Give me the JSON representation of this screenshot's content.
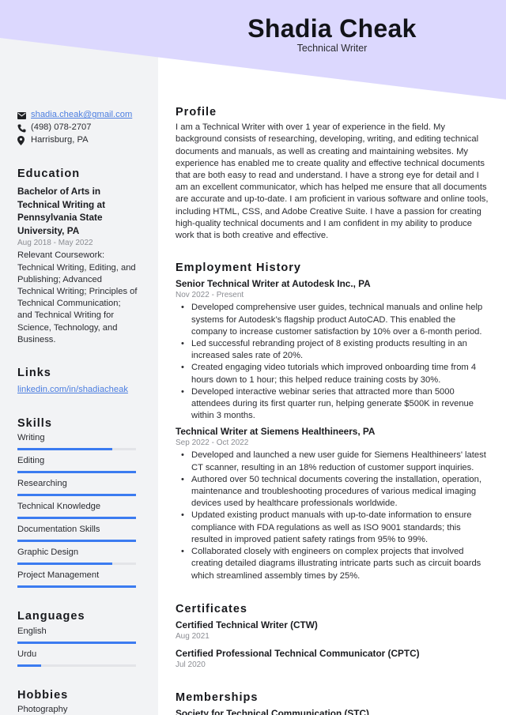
{
  "header": {
    "name": "Shadia Cheak",
    "role": "Technical Writer",
    "accent_color": "#dcd8fe",
    "sidebar_color": "#f2f3f5"
  },
  "contact": {
    "email": "shadia.cheak@gmail.com",
    "phone": "(498) 078-2707",
    "location": "Harrisburg, PA",
    "icons": [
      "envelope-icon",
      "phone-icon",
      "map-pin-icon"
    ]
  },
  "education": {
    "heading": "Education",
    "title": "Bachelor of Arts in Technical Writing at Pennsylvania State University, PA",
    "date": "Aug 2018 - May 2022",
    "description": "Relevant Coursework: Technical Writing, Editing, and Publishing; Advanced Technical Writing; Principles of Technical Communication; and Technical Writing for Science, Technology, and Business."
  },
  "links": {
    "heading": "Links",
    "items": [
      {
        "label": "linkedin.com/in/shadiacheak"
      }
    ]
  },
  "skills": {
    "heading": "Skills",
    "bar_color": "#3b7bf0",
    "items": [
      {
        "label": "Writing",
        "level": 0.8
      },
      {
        "label": "Editing",
        "level": 1.0
      },
      {
        "label": "Researching",
        "level": 1.0
      },
      {
        "label": "Technical Knowledge",
        "level": 1.0
      },
      {
        "label": "Documentation Skills",
        "level": 1.0
      },
      {
        "label": "Graphic Design",
        "level": 0.8
      },
      {
        "label": "Project Management",
        "level": 1.0
      }
    ]
  },
  "languages": {
    "heading": "Languages",
    "items": [
      {
        "label": "English",
        "level": 1.0
      },
      {
        "label": "Urdu",
        "level": 0.2
      }
    ]
  },
  "hobbies": {
    "heading": "Hobbies",
    "items": [
      "Photography"
    ]
  },
  "profile": {
    "heading": "Profile",
    "text": "I am a Technical Writer with over 1 year of experience in the field. My background consists of researching, developing, writing, and editing technical documents and manuals, as well as creating and maintaining websites. My experience has enabled me to create quality and effective technical documents that are both easy to read and understand. I have a strong eye for detail and I am an excellent communicator, which has helped me ensure that all documents are accurate and up-to-date. I am proficient in various software and online tools, including HTML, CSS, and Adobe Creative Suite. I have a passion for creating high-quality technical documents and I am confident in my ability to produce work that is both creative and effective."
  },
  "employment": {
    "heading": "Employment History",
    "jobs": [
      {
        "title": "Senior Technical Writer at Autodesk Inc., PA",
        "date": "Nov 2022 - Present",
        "bullets": [
          "Developed comprehensive user guides, technical manuals and online help systems for Autodesk’s flagship product AutoCAD. This enabled the company to increase customer satisfaction by 10% over a 6-month period.",
          "Led successful rebranding project of 8 existing products resulting in an increased sales rate of 20%.",
          "Created engaging video tutorials which improved onboarding time from 4 hours down to 1 hour; this helped reduce training costs by 30%.",
          "Developed interactive webinar series that attracted more than 5000 attendees during its first quarter run, helping generate $500K in revenue within 3 months."
        ]
      },
      {
        "title": "Technical Writer at Siemens Healthineers, PA",
        "date": "Sep 2022 - Oct 2022",
        "bullets": [
          "Developed and launched a new user guide for Siemens Healthineers' latest CT scanner, resulting in an 18% reduction of customer support inquiries.",
          "Authored over 50 technical documents covering the installation, operation, maintenance and troubleshooting procedures of various medical imaging devices used by healthcare professionals worldwide.",
          "Updated existing product manuals with up-to-date information to ensure compliance with FDA regulations as well as ISO 9001 standards; this resulted in improved patient safety ratings from 95% to 99%.",
          "Collaborated closely with engineers on complex projects that involved creating detailed diagrams illustrating intricate parts such as circuit boards which streamlined assembly times by 25%."
        ]
      }
    ]
  },
  "certificates": {
    "heading": "Certificates",
    "items": [
      {
        "title": "Certified Technical Writer (CTW)",
        "date": "Aug 2021"
      },
      {
        "title": "Certified Professional Technical Communicator (CPTC)",
        "date": "Jul 2020"
      }
    ]
  },
  "memberships": {
    "heading": "Memberships",
    "items": [
      {
        "title": "Society for Technical Communication (STC)"
      }
    ]
  }
}
